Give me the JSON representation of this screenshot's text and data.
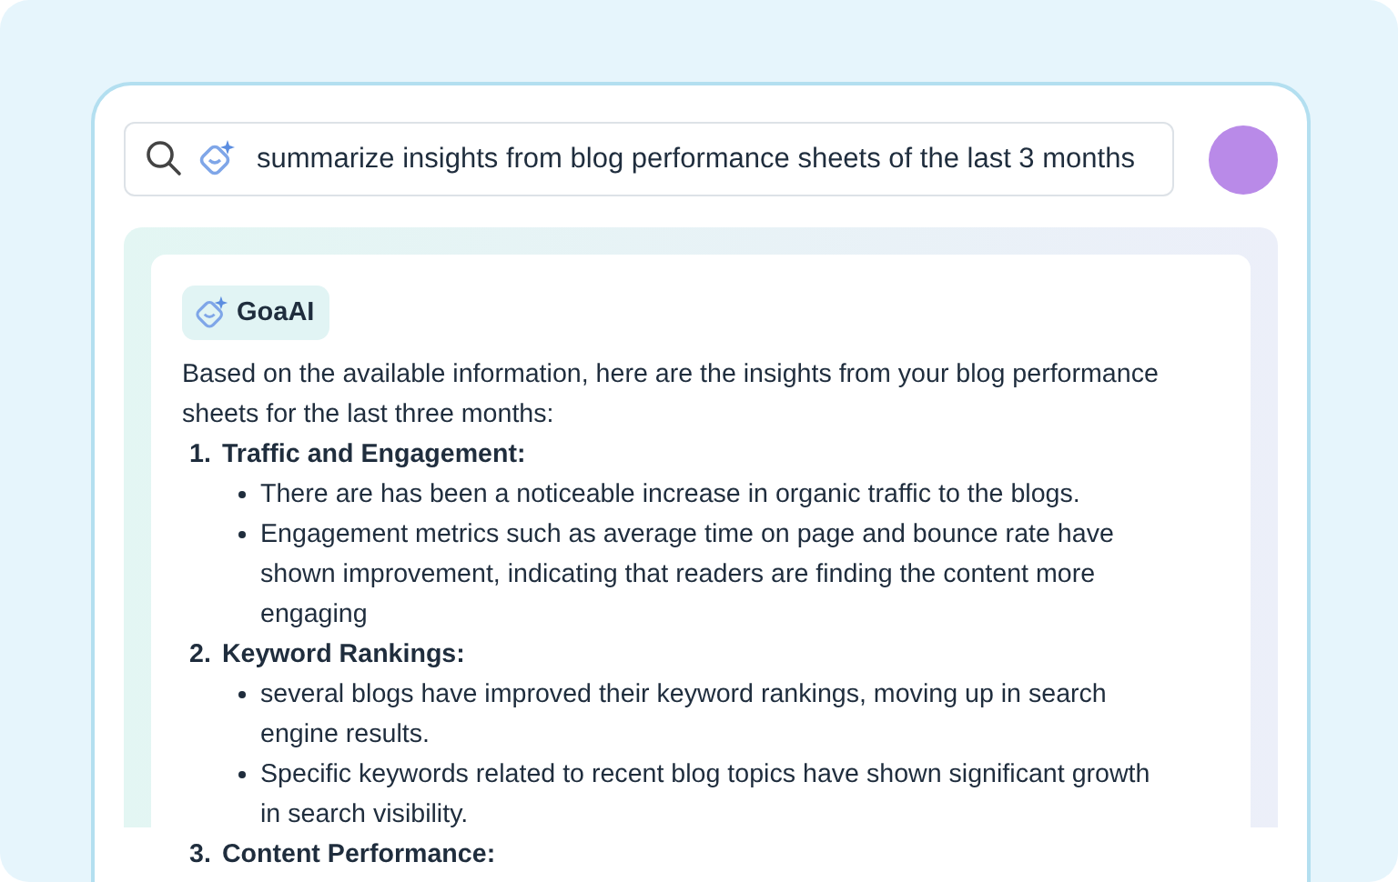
{
  "search": {
    "value": "summarize insights from blog performance sheets of the last 3 months"
  },
  "response": {
    "assistant_name": "GoaAI",
    "intro": "Based on the available information, here are the insights from your blog performance sheets for the last three months:",
    "sections": [
      {
        "number": "1.",
        "title": "Traffic and Engagement:",
        "points": [
          "There are has been a noticeable increase in organic traffic to the blogs.",
          "Engagement metrics such as average time on page and bounce rate have shown improvement, indicating that readers are finding the content more engaging"
        ]
      },
      {
        "number": "2.",
        "title": "Keyword Rankings:",
        "points": [
          "several blogs have improved their keyword rankings, moving up in search engine results.",
          "Specific keywords related to recent blog topics have shown significant growth in search visibility."
        ]
      },
      {
        "number": "3.",
        "title": "Content Performance:"
      }
    ]
  }
}
